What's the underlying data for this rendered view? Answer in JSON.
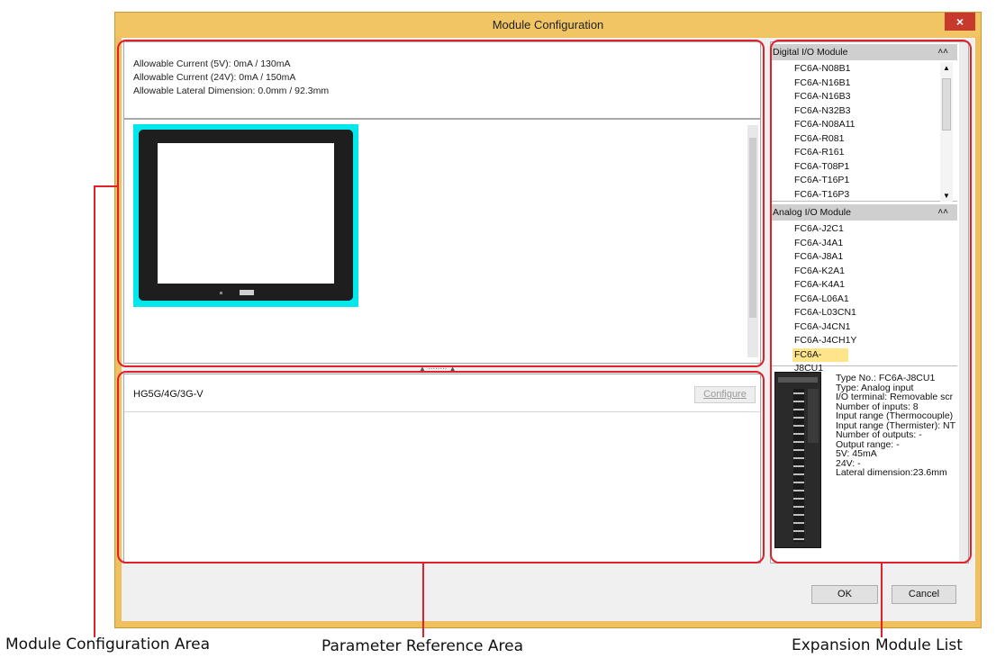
{
  "window": {
    "title": "Module Configuration",
    "close_glyph": "×"
  },
  "module_area": {
    "info": [
      "Allowable Current (5V): 0mA / 130mA",
      "Allowable Current (24V): 0mA / 150mA",
      "Allowable Lateral Dimension: 0.0mm / 92.3mm"
    ]
  },
  "splitter": {
    "glyph": "▲ ········ ▲"
  },
  "parameter_area": {
    "device_name": "HG5G/4G/3G-V",
    "configure_label": "Configure"
  },
  "expansion_list": {
    "digital": {
      "header": "Digital I/O Module",
      "items": [
        "FC6A-N08B1",
        "FC6A-N16B1",
        "FC6A-N16B3",
        "FC6A-N32B3",
        "FC6A-N08A11",
        "FC6A-R081",
        "FC6A-R161",
        "FC6A-T08P1",
        "FC6A-T16P1",
        "FC6A-T16P3"
      ]
    },
    "analog": {
      "header": "Analog I/O Module",
      "items": [
        "FC6A-J2C1",
        "FC6A-J4A1",
        "FC6A-J8A1",
        "FC6A-K2A1",
        "FC6A-K4A1",
        "FC6A-L06A1",
        "FC6A-L03CN1",
        "FC6A-J4CN1",
        "FC6A-J4CH1Y",
        "FC6A-J8CU1"
      ],
      "selected": "FC6A-J8CU1"
    },
    "details": [
      "Type No.: FC6A-J8CU1",
      "Type: Analog input",
      "I/O terminal: Removable scr",
      "Number of inputs: 8",
      "Input range (Thermocouple)",
      "Input range (Thermister): NT",
      "Number of outputs: -",
      "Output range: -",
      "5V: 45mA",
      "24V: -",
      "Lateral dimension:23.6mm"
    ]
  },
  "buttons": {
    "ok": "OK",
    "cancel": "Cancel"
  },
  "callouts": {
    "module_configuration_area": "Module Configuration Area",
    "parameter_reference_area": "Parameter Reference Area",
    "expansion_module_list": "Expansion Module List"
  },
  "colors": {
    "title_bar": "#f2c564",
    "highlight": "#e0202a",
    "selected_item": "#ffe48a",
    "display_frame": "#00e8ec"
  }
}
